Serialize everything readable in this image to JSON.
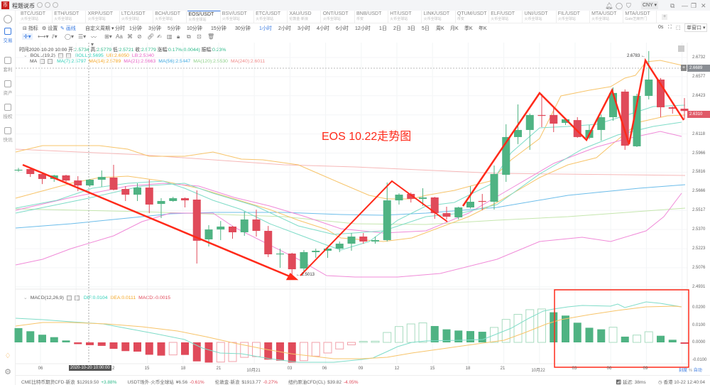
{
  "app": {
    "title": "程题说币",
    "currency": "CNY",
    "window_mode": "单窗口",
    "refresh": "0s"
  },
  "sidebar": {
    "items": [
      {
        "label": "交易",
        "active": true
      },
      {
        "label": "套利"
      },
      {
        "label": "资产"
      },
      {
        "label": "授权"
      },
      {
        "label": "快讯"
      }
    ]
  },
  "tabs": [
    {
      "pair": "BTC/USDT",
      "exchange": "火币全球站"
    },
    {
      "pair": "ETH/USDT",
      "exchange": "火币全球站"
    },
    {
      "pair": "XRP/USDT",
      "exchange": "火币全球站"
    },
    {
      "pair": "LTC/USDT",
      "exchange": "火币全球站"
    },
    {
      "pair": "BCH/USDT",
      "exchange": "火币全球站"
    },
    {
      "pair": "EOS/USDT",
      "exchange": "火币全球站",
      "active": true
    },
    {
      "pair": "BSV/USDT",
      "exchange": "火币全球站"
    },
    {
      "pair": "ETC/USDT",
      "exchange": "火币全球站"
    },
    {
      "pair": "XAU/USD",
      "exchange": "伦敦金·新浪"
    },
    {
      "pair": "ONT/USDT",
      "exchange": "火币全球站"
    },
    {
      "pair": "BNB/USDT",
      "exchange": "币安"
    },
    {
      "pair": "HT/USDT",
      "exchange": "火币全球站"
    },
    {
      "pair": "LINK/USDT",
      "exchange": "火币全球站"
    },
    {
      "pair": "QTUM/USDT",
      "exchange": "币安"
    },
    {
      "pair": "ELF/USDT",
      "exchange": "火币全球站"
    },
    {
      "pair": "UNI/USDT",
      "exchange": "火币全球站"
    },
    {
      "pair": "FIL/USDT",
      "exchange": "火币全球站"
    },
    {
      "pair": "MTA/USDT",
      "exchange": "火币全球站"
    },
    {
      "pair": "MTA/USDT",
      "exchange": "Gate芝麻开门"
    }
  ],
  "toolbar": {
    "indicator": "指标",
    "settings": "设置",
    "draw": "画线",
    "custom_period": "自定义周期 ▾",
    "periods": [
      "分时",
      "1分钟",
      "3分钟",
      "5分钟",
      "10分钟",
      "15分钟",
      "30分钟",
      "1小时",
      "2小时",
      "3小时",
      "4小时",
      "6小时",
      "12小时",
      "1日",
      "2日",
      "3日",
      "5日",
      "周K",
      "月K",
      "季K",
      "年K"
    ],
    "active_period": "1小时"
  },
  "info": {
    "time_label": "时间",
    "time": "2020-10-20 10:00",
    "open_label": "开:",
    "open": "2.5734",
    "high_label": "高:",
    "high": "2.5779",
    "low_label": "低:",
    "low": "2.5721",
    "close_label": "收:",
    "close": "2.5779",
    "change_label": "涨幅:",
    "change": "0.17%(0.0044)",
    "amp_label": "振幅:",
    "amp": "0.23%"
  },
  "boll": {
    "name": "BOLL(19,2)",
    "boll": "BOLL:2.5695",
    "ub": "UB:2.6050",
    "lb": "LB:2.5340"
  },
  "ma": {
    "name": "MA",
    "ma7": "MA(7):2.5797",
    "ma14": "MA(14):2.5789",
    "ma21": "MA(21):2.5663",
    "ma56": "MA(56):2.5447",
    "ma120": "MA(120):2.5530",
    "ma240": "MA(240):2.6011"
  },
  "macd": {
    "name": "MACD(12,26,9)",
    "dif": "DIF:0.0104",
    "dea": "DEA:0.0111",
    "macd": "MACD:-0.0015"
  },
  "annotation": {
    "title": "EOS 10.22走势图",
    "high_label": "2.6783",
    "low_label": "2.5013"
  },
  "price_axis": [
    "2.6732",
    "2.6577",
    "2.6423",
    "2.6270",
    "2.6118",
    "2.5966",
    "2.5816",
    "2.5666",
    "2.5517",
    "2.5370",
    "2.5223",
    "2.5076",
    "2.4931"
  ],
  "current_price": "2.6310",
  "crosshair_price": "2.6689",
  "macd_axis": [
    "0.0200",
    "0.0100",
    "0.0000",
    "-0.0100"
  ],
  "time_axis": [
    "06",
    "12",
    "15",
    "18",
    "21",
    "10月21",
    "03",
    "06",
    "09",
    "12",
    "15",
    "18",
    "21",
    "10月22",
    "03",
    "06",
    "09"
  ],
  "crosshair_time": "2020-10-20 10:00:00",
  "axis_mode": {
    "scale": "刻度",
    "percent": "%",
    "auto": "自动"
  },
  "colors": {
    "up": "#4fb383",
    "down": "#e04a5a",
    "accent": "#3b7be0",
    "annotation": "#ff2a1a"
  },
  "candles": [
    [
      2.584,
      2.586,
      2.583,
      2.5846
    ],
    [
      2.5851,
      2.5857,
      2.5789,
      2.5812
    ],
    [
      2.5812,
      2.5815,
      2.5733,
      2.5773
    ],
    [
      2.5773,
      2.5806,
      2.575,
      2.5801
    ],
    [
      2.5801,
      2.5806,
      2.575,
      2.5761
    ],
    [
      2.5761,
      2.5795,
      2.5677,
      2.5722
    ],
    [
      2.5722,
      2.5772,
      2.5711,
      2.5767
    ],
    [
      2.5767,
      2.584,
      2.5711,
      2.5789
    ],
    [
      2.5784,
      2.5885,
      2.5683,
      2.5688
    ],
    [
      2.5694,
      2.5716,
      2.5599,
      2.5649
    ],
    [
      2.5649,
      2.5739,
      2.5599,
      2.5705
    ],
    [
      2.5705,
      2.5767,
      2.5503,
      2.5571
    ],
    [
      2.5576,
      2.5621,
      2.5464,
      2.5599
    ],
    [
      2.5599,
      2.5632,
      2.5593,
      2.5621
    ],
    [
      2.5621,
      2.5627,
      2.5548,
      2.5604
    ],
    [
      2.561,
      2.5683,
      2.5105,
      2.5285
    ],
    [
      2.5296,
      2.5408,
      2.524,
      2.5374
    ],
    [
      2.5374,
      2.5441,
      2.529,
      2.5397
    ],
    [
      2.5397,
      2.5402,
      2.5301,
      2.5352
    ],
    [
      2.5352,
      2.5515,
      2.5324,
      2.5453
    ],
    [
      2.5453,
      2.5531,
      2.5318,
      2.5363
    ],
    [
      2.5363,
      2.5402,
      2.5156,
      2.5178
    ],
    [
      2.5178,
      2.5223,
      2.5071,
      2.5184
    ],
    [
      2.5184,
      2.519,
      2.5013,
      2.506
    ],
    [
      2.5066,
      2.5212,
      2.5043,
      2.5195
    ],
    [
      2.5195,
      2.5223,
      2.515,
      2.5206
    ],
    [
      2.5206,
      2.5228,
      2.515,
      2.5223
    ],
    [
      2.5223,
      2.5279,
      2.5195,
      2.5262
    ],
    [
      2.5262,
      2.5346,
      2.5206,
      2.5318
    ],
    [
      2.5318,
      2.5346,
      2.5262,
      2.5279
    ],
    [
      2.5279,
      2.5318,
      2.5262,
      2.529
    ],
    [
      2.529,
      2.5745,
      2.5279,
      2.5604
    ],
    [
      2.5604,
      2.566,
      2.5571,
      2.5649
    ],
    [
      2.5655,
      2.5666,
      2.5587,
      2.5616
    ],
    [
      2.5616,
      2.57,
      2.556,
      2.5627
    ],
    [
      2.5627,
      2.5632,
      2.5458,
      2.5503
    ],
    [
      2.5503,
      2.5554,
      2.5453,
      2.5475
    ],
    [
      2.547,
      2.5554,
      2.5453,
      2.5548
    ],
    [
      2.5548,
      2.5716,
      2.554,
      2.5593
    ],
    [
      2.5599,
      2.5655,
      2.5526,
      2.5593
    ],
    [
      2.5593,
      2.5879,
      2.5531,
      2.5812
    ],
    [
      2.5806,
      2.6205,
      2.575,
      2.6104
    ],
    [
      2.6104,
      2.6362,
      2.6048,
      2.616
    ],
    [
      2.616,
      2.629,
      2.6003,
      2.6278
    ],
    [
      2.6278,
      2.6446,
      2.6182,
      2.6272
    ],
    [
      2.6278,
      2.6334,
      2.6143,
      2.621
    ],
    [
      2.6216,
      2.625,
      2.6199,
      2.6244
    ],
    [
      2.6238,
      2.6261,
      2.6098,
      2.6104
    ],
    [
      2.6098,
      2.6199,
      2.6087,
      2.616
    ],
    [
      2.616,
      2.6283,
      2.6076,
      2.6261
    ],
    [
      2.6261,
      2.6496,
      2.6233,
      2.6452
    ],
    [
      2.6463,
      2.648,
      2.6003,
      2.6036
    ],
    [
      2.6031,
      2.6446,
      2.6025,
      2.6429
    ],
    [
      2.6429,
      2.6783,
      2.6401,
      2.6558
    ],
    [
      2.6558,
      2.657,
      2.6261,
      2.6339
    ],
    [
      2.6339,
      2.6345,
      2.6289,
      2.6328
    ],
    [
      2.6328,
      2.6412,
      2.6244,
      2.631
    ]
  ],
  "macd_hist": [
    0.0082,
    0.0064,
    0.0044,
    0.003,
    0.0011,
    -0.001,
    -0.0016,
    -0.002,
    -0.0037,
    -0.005,
    -0.0053,
    -0.0071,
    -0.0076,
    -0.0072,
    -0.0072,
    -0.0109,
    -0.0116,
    -0.0113,
    -0.011,
    -0.0086,
    -0.0082,
    -0.0099,
    -0.0105,
    -0.0116,
    -0.0105,
    -0.0079,
    -0.0061,
    -0.0038,
    -0.0014,
    0.0003,
    0.0007,
    0.0057,
    0.0091,
    0.0106,
    0.0112,
    0.0094,
    0.0075,
    0.0068,
    0.0065,
    0.0061,
    0.0086,
    0.0132,
    0.0161,
    0.0188,
    0.0192,
    0.0173,
    0.0154,
    0.0113,
    0.0084,
    0.0075,
    0.0087,
    0.0033,
    0.0042,
    0.0061,
    0.0038,
    0.0015,
    -0.0008
  ],
  "status": [
    {
      "name": "CME比特币期货CFD·新浪",
      "price": "$12919.50",
      "change": "+3.88%",
      "up": true
    },
    {
      "name": "USDT场外·火币全球站",
      "price": "¥6.56",
      "change": "-0.61%"
    },
    {
      "name": "伦敦金·新浪",
      "price": "$1913.77",
      "change": "-0.27%"
    },
    {
      "name": "纽约原油CFD(CL)",
      "price": "$39.82",
      "change": "-4.05%"
    }
  ],
  "latency": "延迟: 38ms",
  "clock": "香港 10-22 12:40:04"
}
